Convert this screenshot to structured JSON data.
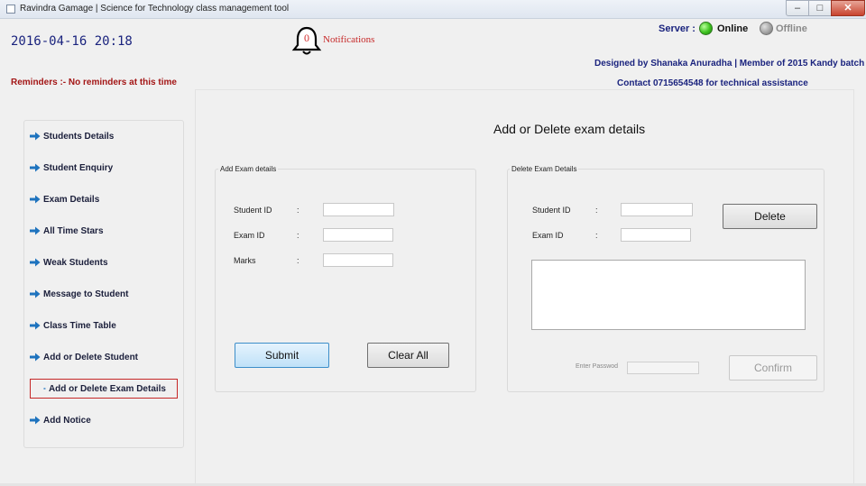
{
  "window": {
    "title": "Ravindra Gamage | Science for Technology class management tool",
    "minimize_glyph": "–",
    "maximize_glyph": "□",
    "close_glyph": "✕"
  },
  "header": {
    "datetime": "2016-04-16 20:18",
    "notifications": {
      "count": "0",
      "label": "Notifications"
    },
    "server": {
      "label": "Server :",
      "online_label": "Online",
      "offline_label": "Offline",
      "status": "online",
      "online_color": "#3cc11e",
      "offline_color": "#9e9e9e"
    },
    "designed_by": "Designed by Shanaka Anuradha | Member of 2015 Kandy  batch",
    "contact": "Contact 0715654548 for technical assistance",
    "reminders": "Reminders :- No reminders at this time"
  },
  "sidebar": {
    "items": [
      {
        "label": "Students Details",
        "active": false
      },
      {
        "label": "Student Enquiry",
        "active": false
      },
      {
        "label": "Exam Details",
        "active": false
      },
      {
        "label": "All Time Stars",
        "active": false
      },
      {
        "label": "Weak Students",
        "active": false
      },
      {
        "label": "Message to Student",
        "active": false
      },
      {
        "label": "Class Time Table",
        "active": false
      },
      {
        "label": "Add or Delete Student",
        "active": false
      },
      {
        "label": "Add or Delete Exam Details",
        "active": true
      },
      {
        "label": "Add Notice",
        "active": false
      }
    ],
    "arrow_icon": "right-arrow-icon",
    "accent_color": "#1e73be",
    "active_border_color": "#c62828"
  },
  "main": {
    "title": "Add or Delete exam details",
    "add_group": {
      "caption": "Add Exam details",
      "fields": [
        {
          "label": "Student ID",
          "colon": ":",
          "value": ""
        },
        {
          "label": "Exam ID",
          "colon": ":",
          "value": ""
        },
        {
          "label": "Marks",
          "colon": ":",
          "value": ""
        }
      ],
      "submit_label": "Submit",
      "clear_label": "Clear All"
    },
    "delete_group": {
      "caption": "Delete Exam Details",
      "fields": [
        {
          "label": "Student ID",
          "colon": ":",
          "value": ""
        },
        {
          "label": "Exam ID",
          "colon": ":",
          "value": ""
        }
      ],
      "delete_label": "Delete",
      "result_text": "",
      "password_label": "Enter Passwod",
      "password_value": "",
      "confirm_label": "Confirm"
    }
  }
}
